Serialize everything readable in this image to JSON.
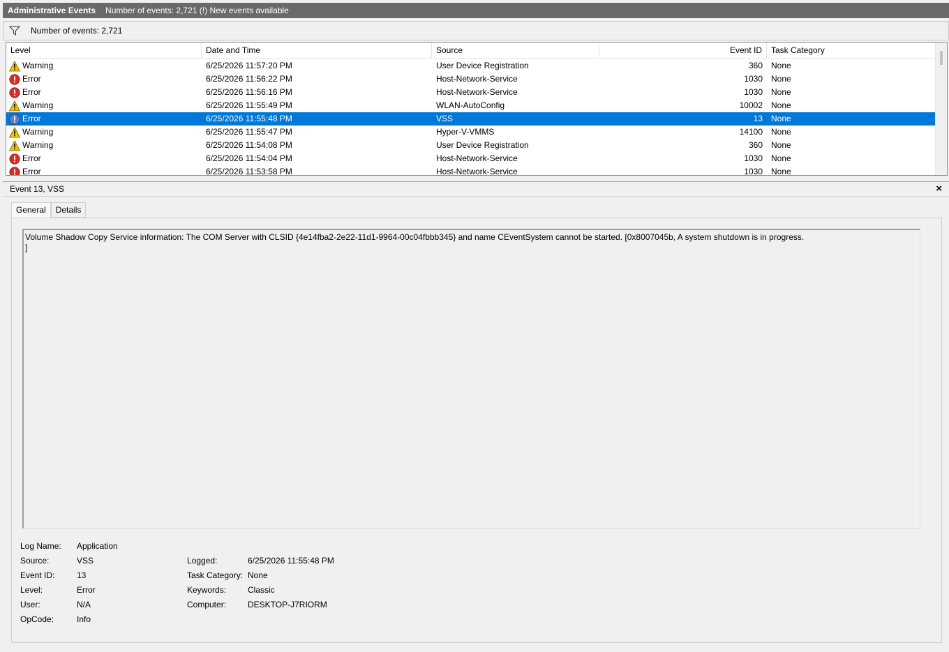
{
  "titlebar": {
    "title": "Administrative Events",
    "info": "Number of events: 2,721 (!) New events available"
  },
  "filterbar": {
    "text": "Number of events: 2,721",
    "icon": "filter-icon"
  },
  "grid": {
    "columns": [
      "Level",
      "Date and Time",
      "Source",
      "Event ID",
      "Task Category"
    ],
    "rows": [
      {
        "level": "Warning",
        "date": "6/25/2026 11:57:20 PM",
        "source": "User Device Registration",
        "id": "360",
        "category": "None"
      },
      {
        "level": "Error",
        "date": "6/25/2026 11:56:22 PM",
        "source": "Host-Network-Service",
        "id": "1030",
        "category": "None"
      },
      {
        "level": "Error",
        "date": "6/25/2026 11:56:16 PM",
        "source": "Host-Network-Service",
        "id": "1030",
        "category": "None"
      },
      {
        "level": "Warning",
        "date": "6/25/2026 11:55:49 PM",
        "source": "WLAN-AutoConfig",
        "id": "10002",
        "category": "None"
      },
      {
        "level": "Error",
        "date": "6/25/2026 11:55:48 PM",
        "source": "VSS",
        "id": "13",
        "category": "None",
        "selected": true
      },
      {
        "level": "Warning",
        "date": "6/25/2026 11:55:47 PM",
        "source": "Hyper-V-VMMS",
        "id": "14100",
        "category": "None"
      },
      {
        "level": "Warning",
        "date": "6/25/2026 11:54:08 PM",
        "source": "User Device Registration",
        "id": "360",
        "category": "None"
      },
      {
        "level": "Error",
        "date": "6/25/2026 11:54:04 PM",
        "source": "Host-Network-Service",
        "id": "1030",
        "category": "None"
      },
      {
        "level": "Error",
        "date": "6/25/2026 11:53:58 PM",
        "source": "Host-Network-Service",
        "id": "1030",
        "category": "None"
      }
    ]
  },
  "detail": {
    "header": "Event 13, VSS",
    "close": "×",
    "tabs": [
      "General",
      "Details"
    ],
    "message": "Volume Shadow Copy Service information: The COM Server with CLSID {4e14fba2-2e22-11d1-9964-00c04fbbb345} and name CEventSystem cannot be started. [0x8007045b, A system shutdown is in progress.\n]",
    "props": {
      "log_name_label": "Log Name:",
      "log_name": "Application",
      "source_label": "Source:",
      "source": "VSS",
      "logged_label": "Logged:",
      "logged": "6/25/2026 11:55:48 PM",
      "event_id_label": "Event ID:",
      "event_id": "13",
      "task_category_label": "Task Category:",
      "task_category": "None",
      "level_label": "Level:",
      "level": "Error",
      "keywords_label": "Keywords:",
      "keywords": "Classic",
      "user_label": "User:",
      "user": "N/A",
      "computer_label": "Computer:",
      "computer": "DESKTOP-J7RIORM",
      "opcode_label": "OpCode:",
      "opcode": "Info"
    }
  },
  "colors": {
    "selection": "#0078d7",
    "titlebar": "#6a6a6a",
    "error": "#d42b2b",
    "warning": "#f5c400",
    "selected_error_icon": "#5a7fc9"
  }
}
